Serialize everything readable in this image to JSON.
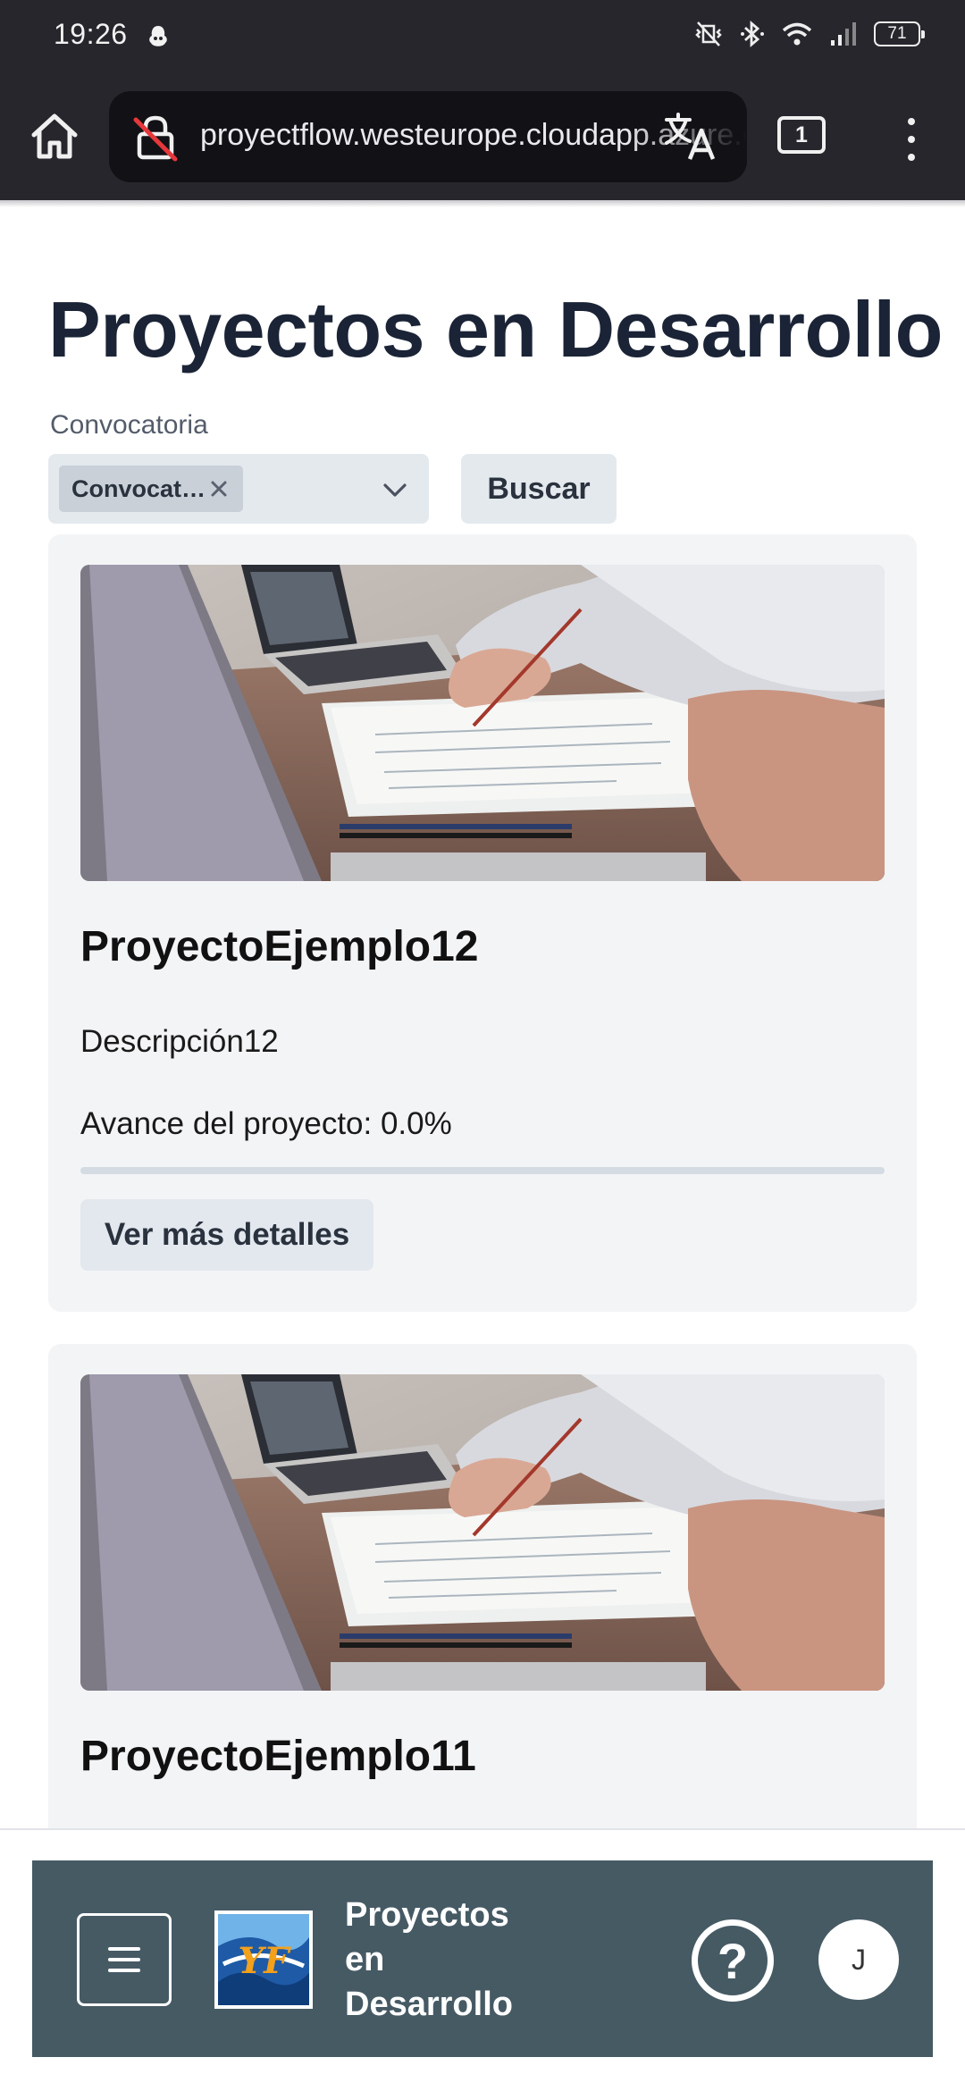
{
  "status_bar": {
    "time": "19:26",
    "battery": "71"
  },
  "browser": {
    "url": "proyectflow.westeurope.cloudapp.azure.com",
    "tab_count": "1"
  },
  "page": {
    "title": "Proyectos en Desarrollo",
    "filter_label": "Convocatoria",
    "filter_chip": "Convocat…",
    "search_button": "Buscar"
  },
  "projects": [
    {
      "name": "ProyectoEjemplo12",
      "description": "Descripción12",
      "progress_text": "Avance del proyecto: 0.0%",
      "progress_percent": 0,
      "details_button": "Ver más detalles"
    },
    {
      "name": "ProyectoEjemplo11"
    }
  ],
  "bottom_bar": {
    "title": "Proyectos en Desarrollo",
    "avatar_initial": "J",
    "help_icon": "?"
  },
  "icons": [
    "home-icon",
    "insecure-lock-icon",
    "translate-icon",
    "more-vert-icon",
    "close-icon",
    "chevron-down-icon",
    "menu-icon",
    "help-icon"
  ]
}
